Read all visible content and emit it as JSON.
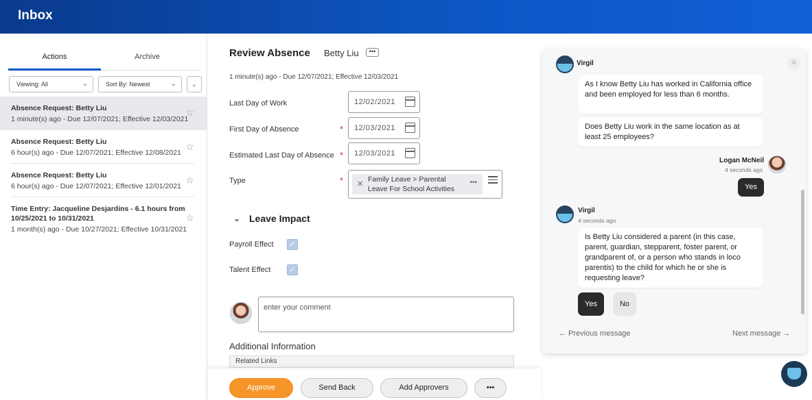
{
  "header": {
    "title": "Inbox"
  },
  "left": {
    "tabs": [
      {
        "label": "Actions"
      },
      {
        "label": "Archive"
      }
    ],
    "filters": {
      "viewing": "Viewing: All",
      "sort": "Sort By: Newest"
    },
    "items": [
      {
        "title": "Absence Request: Betty Liu",
        "meta": "1 minute(s) ago - Due 12/07/2021; Effective 12/03/2021"
      },
      {
        "title": "Absence Request: Betty Liu",
        "meta": "6 hour(s) ago - Due 12/07/2021; Effective 12/08/2021"
      },
      {
        "title": "Absence Request: Betty Liu",
        "meta": "6 hour(s) ago - Due 12/07/2021; Effective 12/01/2021"
      },
      {
        "title": "Time Entry: Jacqueline Desjardins - 6.1 hours from 10/25/2021 to 10/31/2021",
        "meta": "1 month(s) ago - Due 10/27/2021; Effective 10/31/2021"
      }
    ]
  },
  "review": {
    "title": "Review Absence",
    "name": "Betty Liu",
    "more": "•••",
    "subtitle": "1 minute(s) ago - Due 12/07/2021; Effective 12/03/2021",
    "fields": {
      "last_day_label": "Last Day of Work",
      "last_day_value": "12/02/2021",
      "first_day_label": "First Day of Absence",
      "first_day_value": "12/03/2021",
      "est_last_label": "Estimated Last Day of Absence",
      "est_last_value": "12/03/2021",
      "type_label": "Type",
      "type_value_1": "Family Leave > Parental",
      "type_value_2": "Leave For School Activities"
    },
    "leave_impact": {
      "title": "Leave Impact",
      "payroll_label": "Payroll Effect",
      "payroll_checked": true,
      "talent_label": "Talent Effect",
      "talent_checked": true
    },
    "comment_placeholder": "enter your comment",
    "additional_info": "Additional Information",
    "related_links": "Related Links"
  },
  "actions": {
    "approve": "Approve",
    "send_back": "Send Back",
    "add_approvers": "Add Approvers",
    "more": "•••"
  },
  "chat": {
    "bot_name": "Virgil",
    "msg1": "As I know Betty Liu has worked in California office and been employed for less than 6 months.",
    "msg2": "Does Betty Liu work in the same location as at least 25 employees?",
    "user_name": "Logan McNeil",
    "user_time": "4 seconds ago",
    "user_msg": "Yes",
    "bot_time": "4 seconds ago",
    "msg3": "Is Betty Liu considered a parent (in this case, parent, guardian, stepparent, foster parent, or grandparent of, or a person who stands in loco parentis) to the child for which he or she is requesting leave?",
    "reply_yes": "Yes",
    "reply_no": "No",
    "prev": "← Previous message",
    "next": "Next message →"
  }
}
